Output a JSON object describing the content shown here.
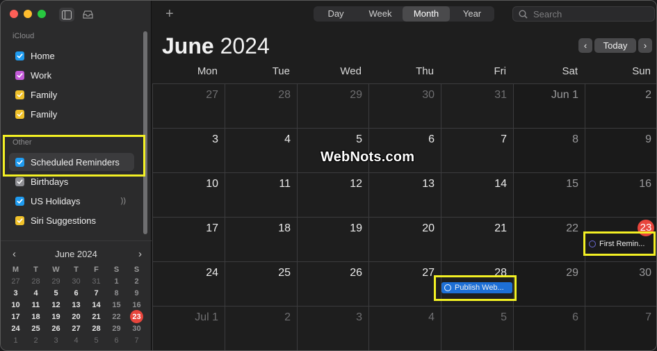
{
  "window": {
    "traffic_lights": [
      "close",
      "minimize",
      "zoom"
    ]
  },
  "sidebar": {
    "icloud_label": "iCloud",
    "icloud_items": [
      {
        "label": "Home",
        "color": "#1f9bf0"
      },
      {
        "label": "Work",
        "color": "#c35bd8"
      },
      {
        "label": "Family",
        "color": "#f0c12a"
      },
      {
        "label": "Family",
        "color": "#f0c12a"
      }
    ],
    "other_label": "Other",
    "other_items": [
      {
        "label": "Scheduled Reminders",
        "color": "#1f9bf0",
        "selected": true
      },
      {
        "label": "Birthdays",
        "color": "#8e8e93"
      },
      {
        "label": "US Holidays",
        "color": "#1f9bf0",
        "icon": "broadcast-icon"
      },
      {
        "label": "Siri Suggestions",
        "color": "#f0c12a"
      }
    ],
    "broadcast_glyph": "))",
    "mini_calendar": {
      "title": "June 2024",
      "prev": "‹",
      "next": "›",
      "weekdays": [
        "M",
        "T",
        "W",
        "T",
        "F",
        "S",
        "S"
      ],
      "weeks": [
        [
          "27",
          "28",
          "29",
          "30",
          "31",
          "1",
          "2"
        ],
        [
          "3",
          "4",
          "5",
          "6",
          "7",
          "8",
          "9"
        ],
        [
          "10",
          "11",
          "12",
          "13",
          "14",
          "15",
          "16"
        ],
        [
          "17",
          "18",
          "19",
          "20",
          "21",
          "22",
          "23"
        ],
        [
          "24",
          "25",
          "26",
          "27",
          "28",
          "29",
          "30"
        ],
        [
          "1",
          "2",
          "3",
          "4",
          "5",
          "6",
          "7"
        ]
      ],
      "today": "23"
    }
  },
  "toolbar": {
    "add_label": "+",
    "views": [
      "Day",
      "Week",
      "Month",
      "Year"
    ],
    "active_view": "Month",
    "search_placeholder": "Search"
  },
  "header": {
    "month": "June",
    "year": "2024",
    "prev": "‹",
    "today": "Today",
    "next": "›"
  },
  "weekdays": [
    "Mon",
    "Tue",
    "Wed",
    "Thu",
    "Fri",
    "Sat",
    "Sun"
  ],
  "weeks": [
    [
      "27",
      "28",
      "29",
      "30",
      "31",
      "Jun 1",
      "2"
    ],
    [
      "3",
      "4",
      "5",
      "6",
      "7",
      "8",
      "9"
    ],
    [
      "10",
      "11",
      "12",
      "13",
      "14",
      "15",
      "16"
    ],
    [
      "17",
      "18",
      "19",
      "20",
      "21",
      "22",
      "23"
    ],
    [
      "24",
      "25",
      "26",
      "27",
      "28",
      "29",
      "30"
    ],
    [
      "Jul 1",
      "2",
      "3",
      "4",
      "5",
      "6",
      "7"
    ]
  ],
  "today_badge": "23",
  "events": [
    {
      "title": "First Remin...",
      "day": "23",
      "style": "outline",
      "color": "#6b6bd6"
    },
    {
      "title": "Publish Web...",
      "day": "28",
      "style": "filled",
      "color": "#1d6fd6"
    }
  ],
  "watermark": "WebNots.com"
}
